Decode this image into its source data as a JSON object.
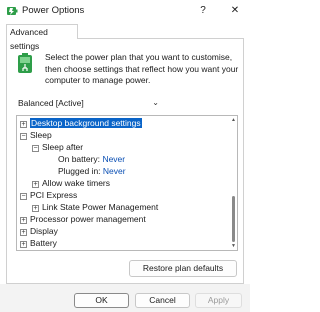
{
  "window": {
    "title": "Power Options",
    "help_glyph": "?",
    "close_glyph": "✕",
    "icon": "power-options-icon"
  },
  "tabs": [
    {
      "label": "Advanced settings",
      "active": true
    }
  ],
  "intro": {
    "icon": "battery-plug-icon",
    "text": "Select the power plan that you want to customise, then choose settings that reflect how you want your computer to manage power."
  },
  "plan_select": {
    "selected": "Balanced [Active]"
  },
  "tree": {
    "items": [
      {
        "expander": "+",
        "label": "Desktop background settings",
        "selected": true
      },
      {
        "expander": "−",
        "label": "Sleep"
      },
      {
        "expander": "−",
        "label": "Sleep after"
      },
      {
        "label": "On battery:",
        "value": "Never"
      },
      {
        "label": "Plugged in:",
        "value": "Never"
      },
      {
        "expander": "+",
        "label": "Allow wake timers"
      },
      {
        "expander": "−",
        "label": "PCI Express"
      },
      {
        "expander": "+",
        "label": "Link State Power Management"
      },
      {
        "expander": "+",
        "label": "Processor power management"
      },
      {
        "expander": "+",
        "label": "Display"
      },
      {
        "expander": "+",
        "label": "Battery"
      }
    ]
  },
  "buttons": {
    "restore": "Restore plan defaults",
    "ok": "OK",
    "cancel": "Cancel",
    "apply": "Apply",
    "apply_enabled": false
  },
  "colors": {
    "selection": "#0a64c8",
    "value_link": "#0a4fb4",
    "footer_bg": "#f3f3f3"
  }
}
